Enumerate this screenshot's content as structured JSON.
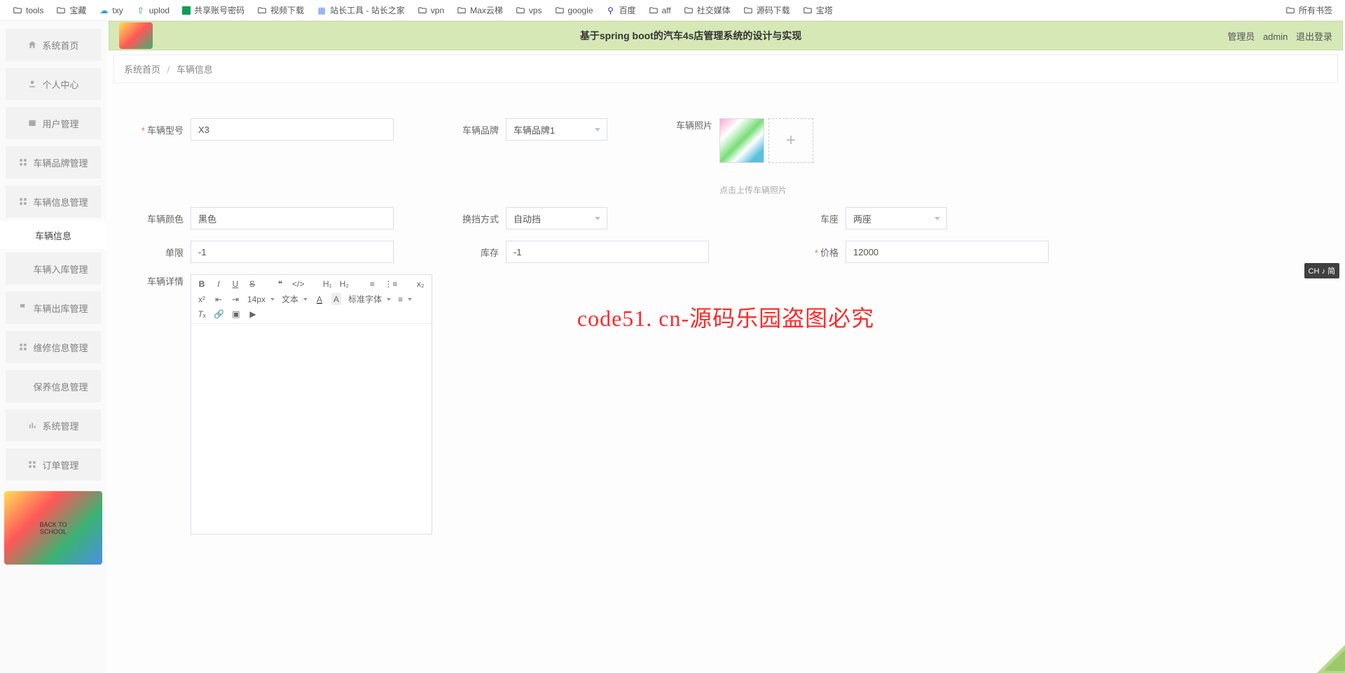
{
  "bookmarks": {
    "items": [
      "tools",
      "宝藏",
      "txy",
      "uplod",
      "共享账号密码",
      "视频下载",
      "站长工具 - 站长之家",
      "vpn",
      "Max云梯",
      "vps",
      "google",
      "百度",
      "aff",
      "社交媒体",
      "源码下载",
      "宝塔"
    ],
    "right": "所有书签"
  },
  "header": {
    "title": "基于spring boot的汽车4s店管理系统的设计与实现",
    "role": "管理员",
    "user": "admin",
    "logout": "退出登录"
  },
  "sidebar": {
    "items": [
      "系统首页",
      "个人中心",
      "用户管理",
      "车辆品牌管理",
      "车辆信息管理",
      "车辆信息",
      "车辆入库管理",
      "车辆出库管理",
      "维修信息管理",
      "保养信息管理",
      "系统管理",
      "订单管理"
    ],
    "active_index": 5
  },
  "breadcrumb": {
    "a": "系统首页",
    "b": "车辆信息"
  },
  "form": {
    "model_label": "车辆型号",
    "model_value": "X3",
    "brand_label": "车辆品牌",
    "brand_value": "车辆品牌1",
    "photo_label": "车辆照片",
    "upload_hint": "点击上传车辆照片",
    "color_label": "车辆颜色",
    "color_value": "黑色",
    "shift_label": "换挡方式",
    "shift_value": "自动挡",
    "seat_label": "车座",
    "seat_value": "两座",
    "limit_label": "单限",
    "limit_value": "-1",
    "stock_label": "库存",
    "stock_value": "-1",
    "price_label": "价格",
    "price_value": "12000",
    "detail_label": "车辆详情"
  },
  "editor": {
    "fontsize": "14px",
    "textlabel": "文本",
    "fontfamily": "标准字体"
  },
  "watermark": "code51. cn-源码乐园盗图必究",
  "ime": "CH ♪ 简"
}
